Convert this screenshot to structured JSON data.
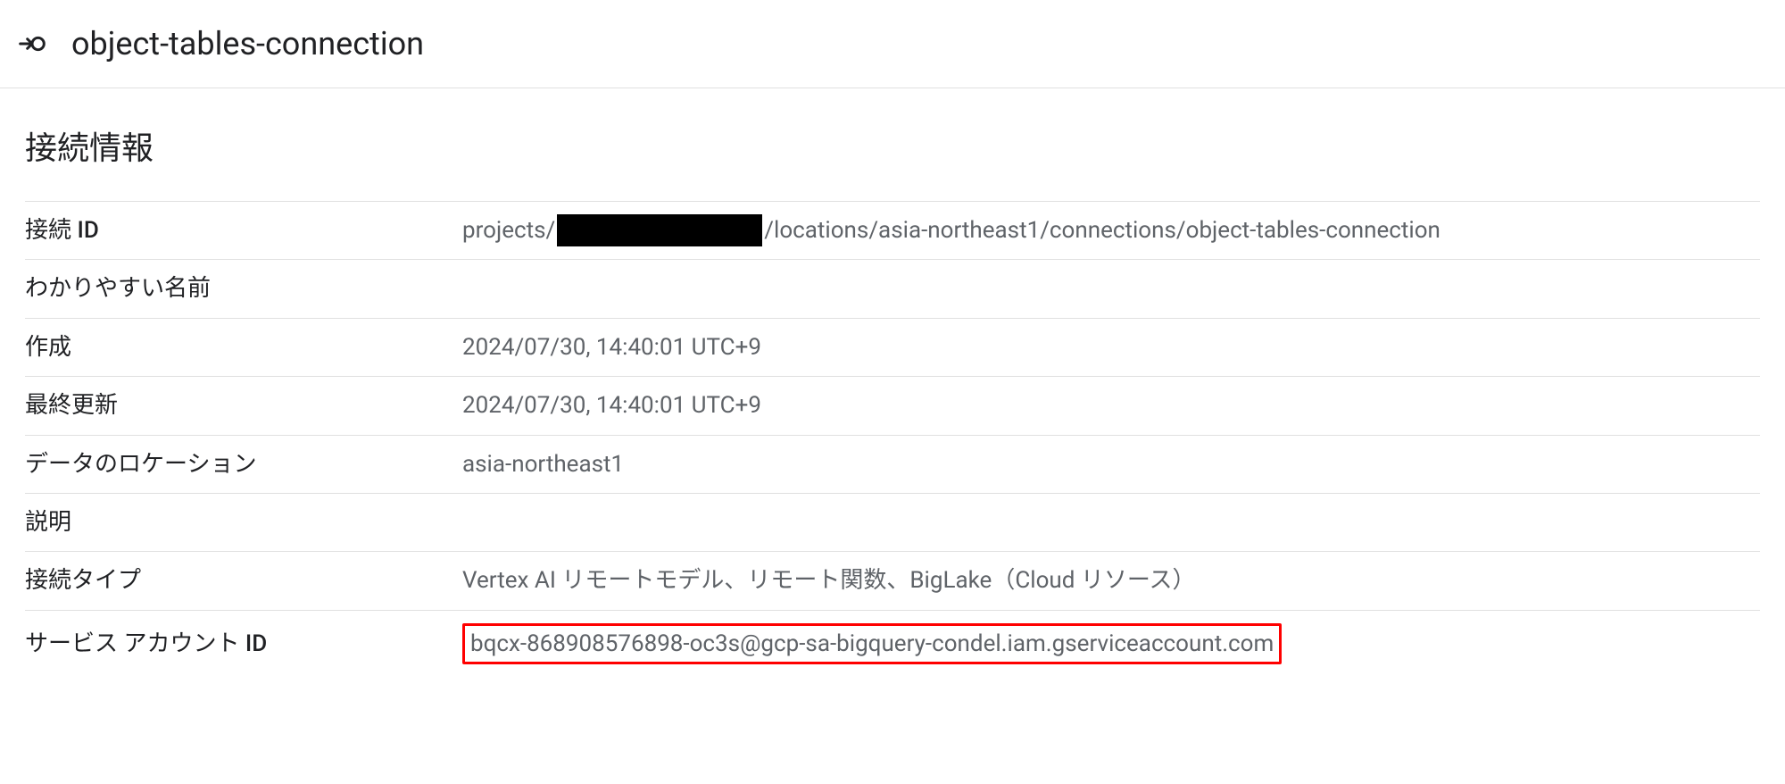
{
  "header": {
    "title": "object-tables-connection"
  },
  "section": {
    "title": "接続情報"
  },
  "rows": {
    "connection_id": {
      "label_prefix": "接続 ",
      "label_suffix": "ID",
      "value_prefix": "projects/",
      "value_suffix": "/locations/asia-northeast1/connections/object-tables-connection"
    },
    "friendly_name": {
      "label": "わかりやすい名前",
      "value": ""
    },
    "created": {
      "label": "作成",
      "value": "2024/07/30, 14:40:01 UTC+9"
    },
    "last_updated": {
      "label": "最終更新",
      "value": "2024/07/30, 14:40:01 UTC+9"
    },
    "data_location": {
      "label": "データのロケーション",
      "value": "asia-northeast1"
    },
    "description": {
      "label": "説明",
      "value": ""
    },
    "connection_type": {
      "label": "接続タイプ",
      "value": "Vertex AI リモートモデル、リモート関数、BigLake（Cloud リソース）"
    },
    "service_account_id": {
      "label_prefix": "サービス アカウント ",
      "label_suffix": "ID",
      "value": "bqcx-868908576898-oc3s@gcp-sa-bigquery-condel.iam.gserviceaccount.com"
    }
  }
}
